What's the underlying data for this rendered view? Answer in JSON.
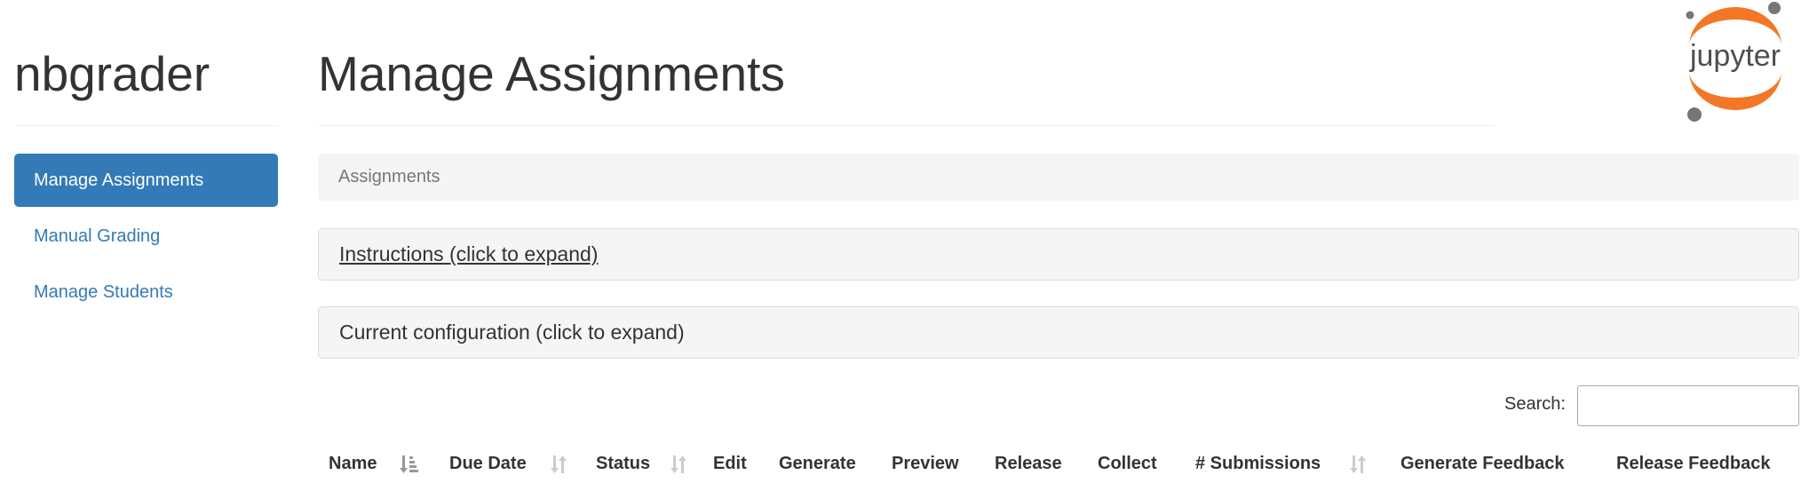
{
  "sidebar": {
    "brand": "nbgrader",
    "items": [
      {
        "label": "Manage Assignments",
        "active": true
      },
      {
        "label": "Manual Grading",
        "active": false
      },
      {
        "label": "Manage Students",
        "active": false
      }
    ]
  },
  "header": {
    "title": "Manage Assignments",
    "logo_text": "jupyter"
  },
  "panels": {
    "assignments_heading": "Assignments",
    "instructions_link": "Instructions",
    "instructions_suffix": " (click to expand)",
    "configuration": "Current configuration (click to expand)"
  },
  "search": {
    "label": "Search:",
    "value": "",
    "placeholder": ""
  },
  "table": {
    "columns": [
      {
        "label": "Name",
        "sortable": true,
        "sort_state": "ascending"
      },
      {
        "label": "Due Date",
        "sortable": true,
        "sort_state": "none"
      },
      {
        "label": "Status",
        "sortable": true,
        "sort_state": "none"
      },
      {
        "label": "Edit",
        "sortable": false
      },
      {
        "label": "Generate",
        "sortable": false
      },
      {
        "label": "Preview",
        "sortable": false
      },
      {
        "label": "Release",
        "sortable": false
      },
      {
        "label": "Collect",
        "sortable": false
      },
      {
        "label": "# Submissions",
        "sortable": true,
        "sort_state": "none"
      },
      {
        "label": "Generate Feedback",
        "sortable": false
      },
      {
        "label": "Release Feedback",
        "sortable": false
      }
    ]
  },
  "colors": {
    "accent": "#337ab7",
    "panel_bg": "#f5f5f5",
    "sort_active": "#999999",
    "sort_inactive": "#cccccc",
    "jupyter_orange": "#f37726",
    "jupyter_grey": "#767677"
  }
}
